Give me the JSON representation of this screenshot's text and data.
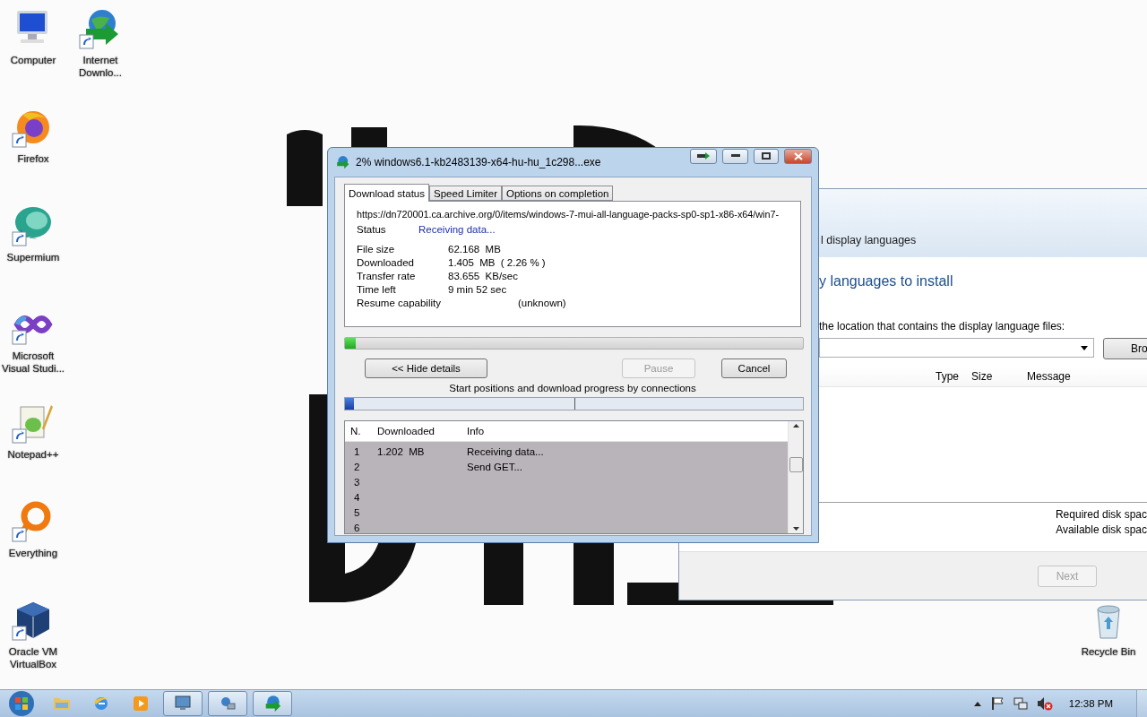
{
  "desktop_icons": [
    {
      "kind": "computer",
      "label": "Computer",
      "shortcut": false
    },
    {
      "kind": "downloader",
      "label": "Internet Downlo...",
      "shortcut": true
    },
    {
      "kind": "firefox",
      "label": "Firefox",
      "shortcut": true
    },
    {
      "kind": "supermium",
      "label": "Supermium",
      "shortcut": true
    },
    {
      "kind": "studio",
      "label": "Microsoft Visual Studi...",
      "shortcut": true
    },
    {
      "kind": "notepad",
      "label": "Notepad++",
      "shortcut": true
    },
    {
      "kind": "everything",
      "label": "Everything",
      "shortcut": true
    },
    {
      "kind": "virtualbox",
      "label": "Oracle VM VirtualBox",
      "shortcut": true
    },
    {
      "kind": "recycle",
      "label": "Recycle Bin",
      "shortcut": false
    }
  ],
  "back_window": {
    "header": "l display languages",
    "heading": "y languages to install",
    "prompt": "the location that contains the display language files:",
    "browse_button": "Bro",
    "columns": [
      "Type",
      "Size",
      "Message"
    ],
    "disk_space": [
      "Required disk spac",
      "Available disk spac"
    ],
    "next_button": {
      "label": "Next",
      "disabled": true
    }
  },
  "download_dialog": {
    "title": "2% windows6.1-kb2483139-x64-hu-hu_1c298...exe",
    "tabs": [
      {
        "label": "Download status",
        "selected": true
      },
      {
        "label": "Speed Limiter",
        "selected": false
      },
      {
        "label": "Options on completion",
        "selected": false
      }
    ],
    "url": "https://dn720001.ca.archive.org/0/items/windows-7-mui-all-language-packs-sp0-sp1-x86-x64/win7-",
    "status": {
      "label": "Status",
      "value": "Receiving data..."
    },
    "details": [
      {
        "label": "File size",
        "value": "62.168  MB"
      },
      {
        "label": "Downloaded",
        "value": "1.405  MB  ( 2.26 % )"
      },
      {
        "label": "Transfer rate",
        "value": "83.655  KB/sec"
      },
      {
        "label": "Time left",
        "value": "9 min 52 sec"
      },
      {
        "label": "Resume capability",
        "value": "(unknown)"
      }
    ],
    "progress": {
      "level": 0.0226
    },
    "buttons": [
      {
        "label": "<< Hide details",
        "disabled": false
      },
      {
        "label": "Pause",
        "disabled": true
      },
      {
        "label": "Cancel",
        "disabled": false
      }
    ],
    "connections_caption": "Start positions and download progress by connections",
    "connections": {
      "level": 0.02
    },
    "table": {
      "columns": [
        "N.",
        "Downloaded",
        "Info"
      ],
      "rows": [
        {
          "n": "1",
          "downloaded": "1.202  MB",
          "info": "Receiving data..."
        },
        {
          "n": "2",
          "info": "Send GET..."
        },
        {
          "n": "3"
        },
        {
          "n": "4"
        },
        {
          "n": "5"
        },
        {
          "n": "6"
        }
      ]
    }
  },
  "taskbar": {
    "items": [
      {
        "kind": "folder",
        "open": false
      },
      {
        "kind": "browser",
        "open": false
      },
      {
        "kind": "media",
        "open": false
      },
      {
        "kind": "monitor",
        "open": true
      },
      {
        "kind": "network",
        "open": true
      },
      {
        "kind": "downloader",
        "open": true
      }
    ],
    "clock": "12:38 PM"
  }
}
